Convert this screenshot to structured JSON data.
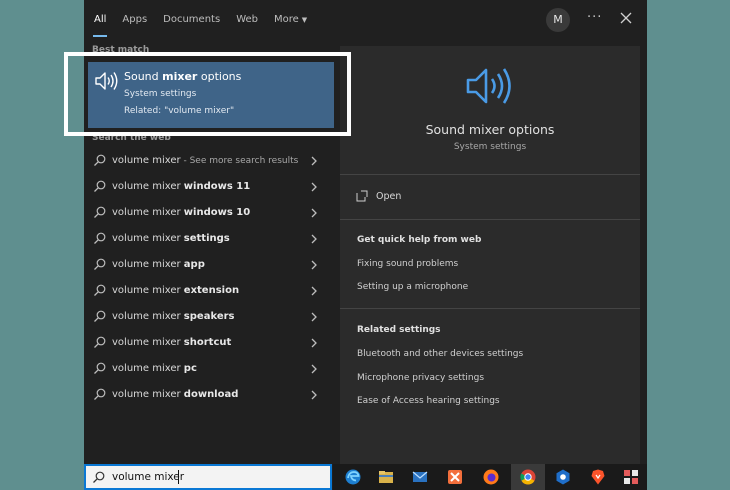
{
  "nav": {
    "tabs": [
      "All",
      "Apps",
      "Documents",
      "Web"
    ],
    "more_label": "More",
    "avatar_initial": "M"
  },
  "best_match": {
    "heading": "Best match",
    "title_pre": "Sound ",
    "title_bold": "mixer",
    "title_post": " options",
    "subtitle": "System settings",
    "related": "Related: \"volume mixer\""
  },
  "web_section": {
    "heading": "Search the web",
    "items": [
      {
        "base": "volume mixer",
        "bold": "",
        "extra": " - See more search results"
      },
      {
        "base": "volume mixer ",
        "bold": "windows 11",
        "extra": ""
      },
      {
        "base": "volume mixer ",
        "bold": "windows 10",
        "extra": ""
      },
      {
        "base": "volume mixer ",
        "bold": "settings",
        "extra": ""
      },
      {
        "base": "volume mixer ",
        "bold": "app",
        "extra": ""
      },
      {
        "base": "volume mixer ",
        "bold": "extension",
        "extra": ""
      },
      {
        "base": "volume mixer ",
        "bold": "speakers",
        "extra": ""
      },
      {
        "base": "volume mixer ",
        "bold": "shortcut",
        "extra": ""
      },
      {
        "base": "volume mixer ",
        "bold": "pc",
        "extra": ""
      },
      {
        "base": "volume mixer ",
        "bold": "download",
        "extra": ""
      }
    ]
  },
  "preview": {
    "title": "Sound mixer options",
    "subtitle": "System settings",
    "open_label": "Open",
    "help_heading": "Get quick help from web",
    "help_links": [
      "Fixing sound problems",
      "Setting up a microphone"
    ],
    "related_heading": "Related settings",
    "related_links": [
      "Bluetooth and other devices settings",
      "Microphone privacy settings",
      "Ease of Access hearing settings"
    ]
  },
  "search": {
    "value": "volume mixer"
  },
  "taskbar": {
    "icons": [
      "edge-icon",
      "file-explorer-icon",
      "mail-icon",
      "xampp-icon",
      "firefox-icon",
      "chrome-icon",
      "app-hex-icon",
      "brave-icon",
      "grid-app-icon"
    ]
  },
  "colors": {
    "accent": "#3f6488",
    "panel": "#202020",
    "preview": "#2b2b2b",
    "desktop": "#5f8f8f",
    "focus": "#0a78d4"
  }
}
